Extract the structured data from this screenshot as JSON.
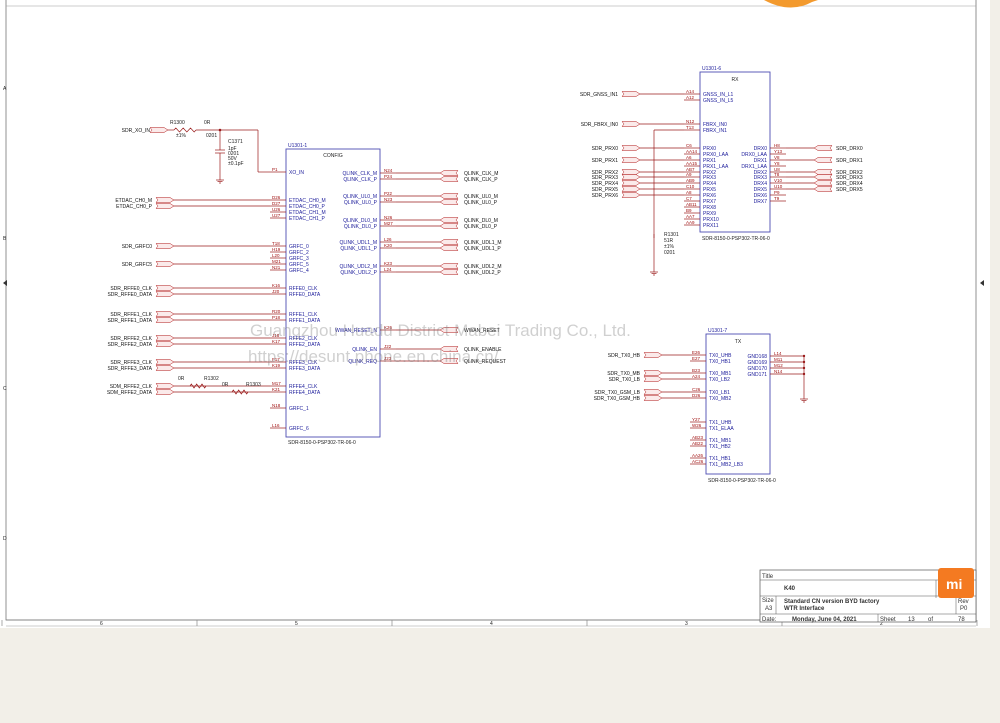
{
  "watermark": {
    "line1": "Guangzhou Huadu District Mabei Trading Co., Ltd.",
    "line2": "https://desunt.phone.en.china.cn/"
  },
  "u1": {
    "ref": "U1301-1",
    "part": "SDR-8150-0-PSP302-TR-06-0",
    "inner": "CONFIG",
    "left_pins": [
      {
        "net": "SDR_XO_IN",
        "pin": "P1",
        "sig": "XO_IN"
      },
      {
        "net": "ETDAC_CH0_M",
        "pin": "D26",
        "sig": "ETDAC_CH0_M"
      },
      {
        "net": "ETDAC_CH0_P",
        "pin": "D27",
        "sig": "ETDAC_CH0_P"
      },
      {
        "net": "",
        "pin": "U26",
        "sig": "ETDAC_CH1_M"
      },
      {
        "net": "",
        "pin": "U27",
        "sig": "ETDAC_CH1_P"
      },
      {
        "net": "SDR_GRFC0",
        "pin": "T18",
        "sig": "GRFC_0"
      },
      {
        "net": "",
        "pin": "H19",
        "sig": "GRFC_2"
      },
      {
        "net": "",
        "pin": "L20",
        "sig": "GRFC_3"
      },
      {
        "net": "SDR_GRFC5",
        "pin": "M21",
        "sig": "GRFC_5"
      },
      {
        "net": "",
        "pin": "N21",
        "sig": "GRFC_4"
      },
      {
        "net": "SDR_RFFE0_CLK",
        "pin": "K16",
        "sig": "RFFE0_CLK"
      },
      {
        "net": "SDR_RFFE0_DATA",
        "pin": "J20",
        "sig": "RFFE0_DATA"
      },
      {
        "net": "SDR_RFFE1_CLK",
        "pin": "R20",
        "sig": "RFFE1_CLK"
      },
      {
        "net": "SDR_RFFE1_DATA",
        "pin": "P18",
        "sig": "RFFE1_DATA"
      },
      {
        "net": "SDR_RFFE2_CLK",
        "pin": "J18",
        "sig": "RFFE2_CLK"
      },
      {
        "net": "SDR_RFFE2_DATA",
        "pin": "K17",
        "sig": "RFFE2_DATA"
      },
      {
        "net": "SDR_RFFE3_CLK",
        "pin": "F17",
        "sig": "RFFE3_CLK"
      },
      {
        "net": "SDR_RFFE3_DATA",
        "pin": "K19",
        "sig": "RFFE3_DATA"
      },
      {
        "net": "SDM_RFFE2_CLK",
        "pin": "M17",
        "sig": "RFFE4_CLK"
      },
      {
        "net": "SDM_RFFE2_DATA",
        "pin": "K21",
        "sig": "RFFE4_DATA"
      },
      {
        "net": "",
        "pin": "N18",
        "sig": "GRFC_1"
      },
      {
        "net": "",
        "pin": "L16",
        "sig": "GRFC_6"
      }
    ],
    "right_pins": [
      {
        "sig": "QLINK_CLK_M",
        "pin": "N24",
        "net": "QLINK_CLK_M"
      },
      {
        "sig": "QLINK_CLK_P",
        "pin": "P24",
        "net": "QLINK_CLK_P"
      },
      {
        "sig": "QLINK_UL0_M",
        "pin": "P22",
        "net": "QLINK_UL0_M"
      },
      {
        "sig": "QLINK_UL0_P",
        "pin": "N23",
        "net": "QLINK_UL0_P"
      },
      {
        "sig": "QLINK_DL0_M",
        "pin": "N26",
        "net": "QLINK_DL0_M"
      },
      {
        "sig": "QLINK_DL0_P",
        "pin": "M27",
        "net": "QLINK_DL0_P"
      },
      {
        "sig": "QLINK_UDL1_M",
        "pin": "L26",
        "net": "QLINK_UDL1_M"
      },
      {
        "sig": "QLINK_UDL1_P",
        "pin": "K20",
        "net": "QLINK_UDL1_P"
      },
      {
        "sig": "QLINK_UDL2_M",
        "pin": "K23",
        "net": "QLINK_UDL2_M"
      },
      {
        "sig": "QLINK_UDL2_P",
        "pin": "L24",
        "net": "QLINK_UDL2_P"
      },
      {
        "sig": "WWAN_RESET_N",
        "pin": "K26",
        "net": "WWAN_RESET"
      },
      {
        "sig": "QLINK_EN",
        "pin": "J22",
        "net": "QLINK_ENABLE"
      },
      {
        "sig": "QLINK_REQ",
        "pin": "J23",
        "net": "QLINK_REQUEST"
      }
    ]
  },
  "passives": {
    "r1300": {
      "ref": "R1300",
      "val": "0R",
      "pkg": "0201",
      "extra": "±1%"
    },
    "c1371": {
      "ref": "C1371",
      "lines": [
        "1pF",
        "0201",
        "50V",
        "±0.1pF"
      ]
    },
    "r1302": {
      "ref": "R1302",
      "val": "0R"
    },
    "r1303": {
      "ref": "R1303",
      "val": "0R"
    },
    "r1301": {
      "ref": "R1301",
      "lines": [
        "51R",
        "±1%",
        "0201"
      ]
    }
  },
  "u2": {
    "ref": "U1301-6",
    "part": "SDR-8150-0-PSP302-TR-06-0",
    "inner": "RX",
    "left_pins": [
      {
        "net": "SDR_GNSS_IN1",
        "pin": "A14",
        "sig": "GNSS_IN_L1"
      },
      {
        "net": "",
        "pin": "A12",
        "sig": "GNSS_IN_L5"
      },
      {
        "net": "SDR_FBRX_IN0",
        "pin": "N12",
        "sig": "FBRX_IN0"
      },
      {
        "net": "",
        "pin": "T13",
        "sig": "FBRX_IN1"
      },
      {
        "net": "SDR_PRX0",
        "pin": "C6",
        "sig": "PRX0"
      },
      {
        "net": "",
        "pin": "AA14",
        "sig": "PRX0_LAA"
      },
      {
        "net": "SDR_PRX1",
        "pin": "A6",
        "sig": "PRX1"
      },
      {
        "net": "",
        "pin": "AA15",
        "sig": "PRX1_LAA"
      },
      {
        "net": "SDR_PRX2",
        "pin": "AB7",
        "sig": "PRX2"
      },
      {
        "net": "SDR_PRX3",
        "pin": "A9",
        "sig": "PRX3"
      },
      {
        "net": "SDR_PRX4",
        "pin": "AB9",
        "sig": "PRX4"
      },
      {
        "net": "SDR_PRX5",
        "pin": "C10",
        "sig": "PRX5"
      },
      {
        "net": "SDR_PRX6",
        "pin": "A8",
        "sig": "PRX6"
      },
      {
        "net": "",
        "pin": "C7",
        "sig": "PRX7"
      },
      {
        "net": "",
        "pin": "AB11",
        "sig": "PRX8"
      },
      {
        "net": "",
        "pin": "B9",
        "sig": "PRX9"
      },
      {
        "net": "",
        "pin": "AA7",
        "sig": "PRX10"
      },
      {
        "net": "",
        "pin": "AA9",
        "sig": "PRX11"
      }
    ],
    "right_pins": [
      {
        "sig": "DRX0",
        "pin": "H8",
        "net": "SDR_DRX0"
      },
      {
        "sig": "DRX0_LAA",
        "pin": "Y13",
        "net": ""
      },
      {
        "sig": "DRX1",
        "pin": "V8",
        "net": "SDR_DRX1"
      },
      {
        "sig": "DRX1_LAA",
        "pin": "Y8",
        "net": ""
      },
      {
        "sig": "DRX2",
        "pin": "U8",
        "net": "SDR_DRX2"
      },
      {
        "sig": "DRX3",
        "pin": "T8",
        "net": "SDR_DRX3"
      },
      {
        "sig": "DRX4",
        "pin": "V10",
        "net": "SDR_DRX4"
      },
      {
        "sig": "DRX5",
        "pin": "U10",
        "net": "SDR_DRX5"
      },
      {
        "sig": "DRX6",
        "pin": "P9",
        "net": ""
      },
      {
        "sig": "DRX7",
        "pin": "T9",
        "net": ""
      }
    ]
  },
  "u3": {
    "ref": "U1301-7",
    "part": "SDR-8150-0-PSP302-TR-06-0",
    "inner": "TX",
    "left_pins": [
      {
        "net": "SDR_TX0_HB",
        "pin": "E26",
        "sig": "TX0_UHB"
      },
      {
        "net": "",
        "pin": "E27",
        "sig": "TX0_HB1"
      },
      {
        "net": "SDR_TX0_MB",
        "pin": "B23",
        "sig": "TX0_MB1"
      },
      {
        "net": "SDR_TX0_LB",
        "pin": "A24",
        "sig": "TX0_LB2"
      },
      {
        "net": "SDR_TX0_GSM_LB",
        "pin": "C26",
        "sig": "TX0_LB1"
      },
      {
        "net": "SDR_TX0_GSM_HB",
        "pin": "D26",
        "sig": "TX0_MB2"
      },
      {
        "net": "",
        "pin": "Y27",
        "sig": "TX1_UHB"
      },
      {
        "net": "",
        "pin": "W26",
        "sig": "TX1_ELAA"
      },
      {
        "net": "",
        "pin": "AB23",
        "sig": "TX1_MB1"
      },
      {
        "net": "",
        "pin": "AB22",
        "sig": "TX1_HB2"
      },
      {
        "net": "",
        "pin": "AA26",
        "sig": "TX1_HB1"
      },
      {
        "net": "",
        "pin": "AC26",
        "sig": "TX1_MB2_LB3"
      }
    ],
    "right_pins": [
      {
        "sig": "GND168",
        "pin": "L14"
      },
      {
        "sig": "GND169",
        "pin": "M11"
      },
      {
        "sig": "GND170",
        "pin": "M12"
      },
      {
        "sig": "GND171",
        "pin": "N14"
      }
    ]
  },
  "titleblock": {
    "title_label": "Title",
    "title_value": "K40",
    "size_label": "Size",
    "size_value": "A3",
    "doc_value": "Standard CN version BYD factory",
    "doc_sub": "WTR Interface",
    "rev_label": "Rev",
    "rev_value": "P0",
    "date_label": "Date:",
    "date_value": "Monday, June 04, 2021",
    "sheet_label": "Sheet",
    "sheet_value": "13",
    "of_label": "of",
    "of_value": "78",
    "logo_text": "mi"
  },
  "border": {
    "left_letters": [
      "A",
      "B",
      "C",
      "D"
    ],
    "bottom_numbers": [
      "6",
      "5",
      "4",
      "3",
      "2",
      "1"
    ]
  }
}
